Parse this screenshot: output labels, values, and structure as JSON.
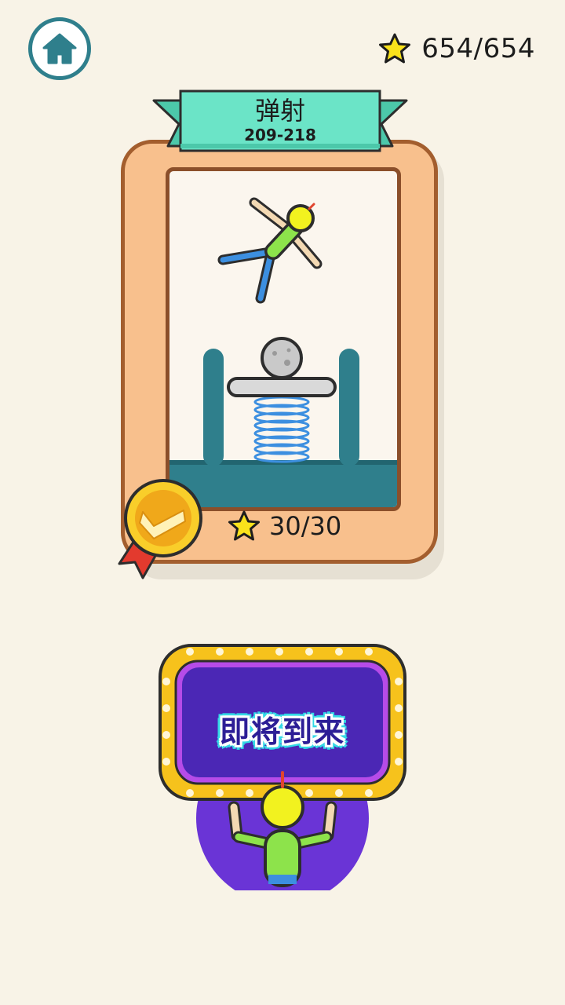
{
  "header": {
    "home_icon": "house-icon",
    "total_stars": "654/654"
  },
  "level_card": {
    "title": "弹射",
    "range": "209-218",
    "stars": "30/30",
    "completed_medal_icon": "checkmark-medal-icon",
    "colors": {
      "ribbon": "#6BE4C7",
      "frame": "#F8C08D",
      "frame_border": "#A35E2E",
      "water": "#2F7F8C"
    }
  },
  "coming_soon": {
    "label": "即将到来",
    "colors": {
      "board": "#6A34D6",
      "frame": "#F6C21C"
    }
  }
}
